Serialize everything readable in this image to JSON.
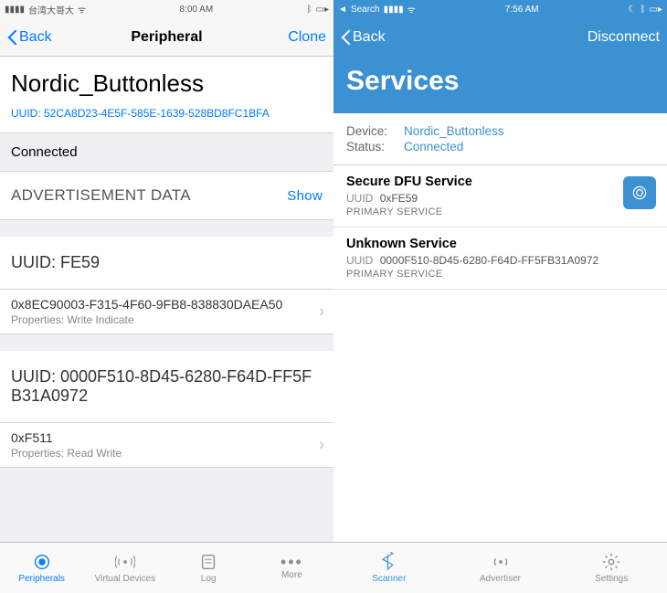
{
  "left": {
    "statusbar": {
      "carrier": "台湾大哥大",
      "time": "8:00 AM",
      "battery": ""
    },
    "nav": {
      "back": "Back",
      "title": "Peripheral",
      "right": "Clone"
    },
    "device_name": "Nordic_Buttonless",
    "device_uuid_label": "UUID: 52CA8D23-4E5F-585E-1639-528BD8FC1BFA",
    "status": "Connected",
    "adv": {
      "title": "ADVERTISEMENT DATA",
      "action": "Show"
    },
    "services": [
      {
        "uuid_label": "UUID: FE59",
        "chars": [
          {
            "name": "0x8EC90003-F315-4F60-9FB8-838830DAEA50",
            "props": "Properties: Write Indicate"
          }
        ]
      },
      {
        "uuid_label": "UUID: 0000F510-8D45-6280-F64D-FF5FB31A0972",
        "chars": [
          {
            "name": "0xF511",
            "props": "Properties: Read Write"
          }
        ]
      }
    ],
    "tabs": [
      "Peripherals",
      "Virtual Devices",
      "Log",
      "More"
    ]
  },
  "right": {
    "statusbar": {
      "back": "Search",
      "time": "7:56 AM",
      "battery": ""
    },
    "nav": {
      "back": "Back",
      "right": "Disconnect"
    },
    "header": "Services",
    "device": {
      "device_label": "Device:",
      "device_value": "Nordic_Buttonless",
      "status_label": "Status:",
      "status_value": "Connected"
    },
    "services": [
      {
        "name": "Secure DFU Service",
        "uuid_label": "UUID",
        "uuid": "0xFE59",
        "kind": "PRIMARY SERVICE",
        "badge": true
      },
      {
        "name": "Unknown Service",
        "uuid_label": "UUID",
        "uuid": "0000F510-8D45-6280-F64D-FF5FB31A0972",
        "kind": "PRIMARY SERVICE",
        "badge": false
      }
    ],
    "tabs": [
      "Scanner",
      "Advertiser",
      "Settings"
    ]
  }
}
